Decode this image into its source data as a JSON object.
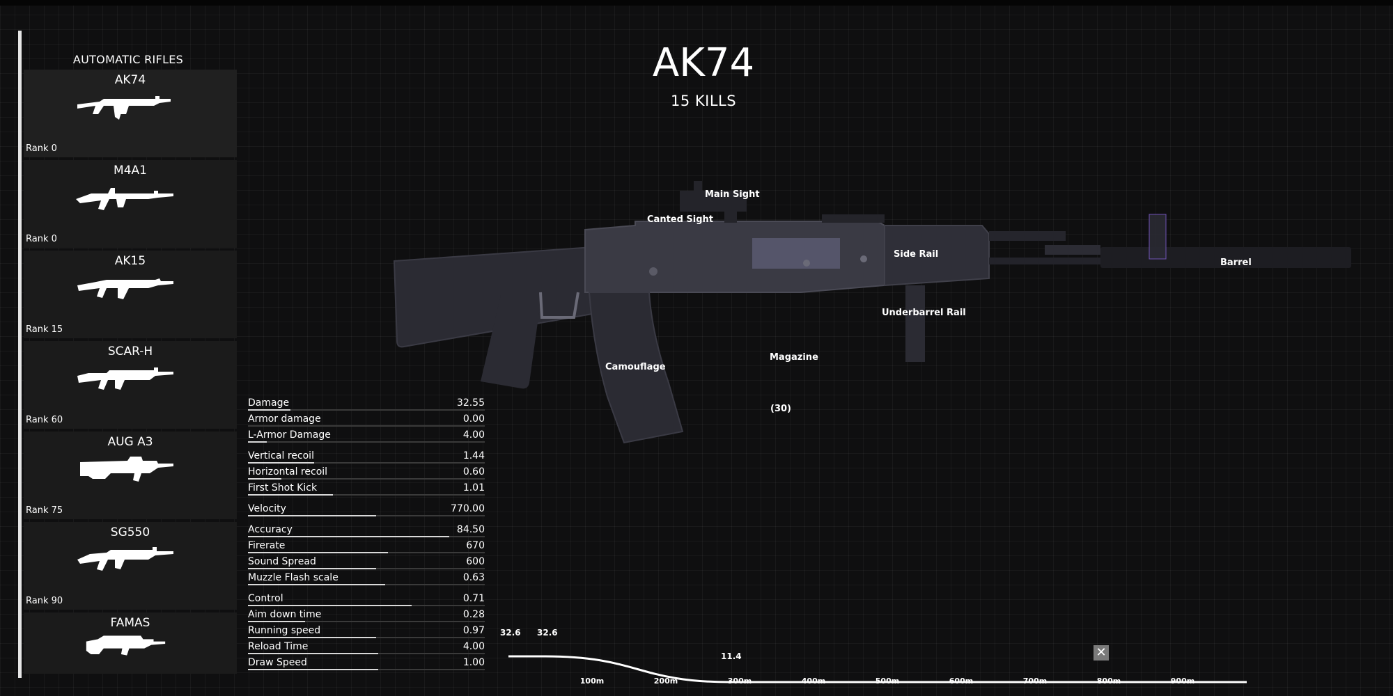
{
  "category": "AUTOMATIC RIFLES",
  "weapons": [
    {
      "name": "AK74",
      "rank": "Rank 0"
    },
    {
      "name": "M4A1",
      "rank": "Rank 0"
    },
    {
      "name": "AK15",
      "rank": "Rank 15"
    },
    {
      "name": "SCAR-H",
      "rank": "Rank 60"
    },
    {
      "name": "AUG A3",
      "rank": "Rank 75"
    },
    {
      "name": "SG550",
      "rank": "Rank 90"
    },
    {
      "name": "FAMAS",
      "rank": ""
    }
  ],
  "selected": {
    "name": "AK74",
    "kills": "15 KILLS"
  },
  "attachments": {
    "main_sight": "Main Sight",
    "canted_sight": "Canted Sight",
    "side_rail": "Side Rail",
    "barrel": "Barrel",
    "underbarrel": "Underbarrel Rail",
    "camouflage": "Camouflage",
    "magazine": "Magazine",
    "magazine_count": "(30)"
  },
  "stats": [
    {
      "label": "Damage",
      "value": "32.55",
      "fill": 0.18
    },
    {
      "label": "Armor damage",
      "value": "0.00",
      "fill": 0.0
    },
    {
      "label": "L-Armor Damage",
      "value": "4.00",
      "fill": 0.08
    },
    {
      "label": "Vertical recoil",
      "value": "1.44",
      "fill": 0.28
    },
    {
      "label": "Horizontal recoil",
      "value": "0.60",
      "fill": 0.14
    },
    {
      "label": "First Shot Kick",
      "value": "1.01",
      "fill": 0.36
    },
    {
      "label": "Velocity",
      "value": "770.00",
      "fill": 0.54
    },
    {
      "label": "Accuracy",
      "value": "84.50",
      "fill": 0.85
    },
    {
      "label": "Firerate",
      "value": "670",
      "fill": 0.59
    },
    {
      "label": "Sound Spread",
      "value": "600",
      "fill": 0.54
    },
    {
      "label": "Muzzle Flash scale",
      "value": "0.63",
      "fill": 0.58
    },
    {
      "label": "Control",
      "value": "0.71",
      "fill": 0.69
    },
    {
      "label": "Aim down time",
      "value": "0.28",
      "fill": 0.24
    },
    {
      "label": "Running speed",
      "value": "0.97",
      "fill": 0.54
    },
    {
      "label": "Reload Time",
      "value": "4.00",
      "fill": 0.55
    },
    {
      "label": "Draw Speed",
      "value": "1.00",
      "fill": 0.55
    }
  ],
  "falloff": {
    "damage_labels": [
      "32.6",
      "32.6",
      "11.4"
    ],
    "distances": [
      "100m",
      "200m",
      "300m",
      "400m",
      "500m",
      "600m",
      "700m",
      "800m",
      "900m"
    ],
    "curve": [
      {
        "m": 0,
        "d": 32.6
      },
      {
        "m": 50,
        "d": 32.6
      },
      {
        "m": 300,
        "d": 11.4
      },
      {
        "m": 1000,
        "d": 11.4
      }
    ],
    "close_symbol": "✕"
  },
  "icons": {
    "close": "close-icon",
    "weapon": "rifle-silhouette-icon"
  }
}
